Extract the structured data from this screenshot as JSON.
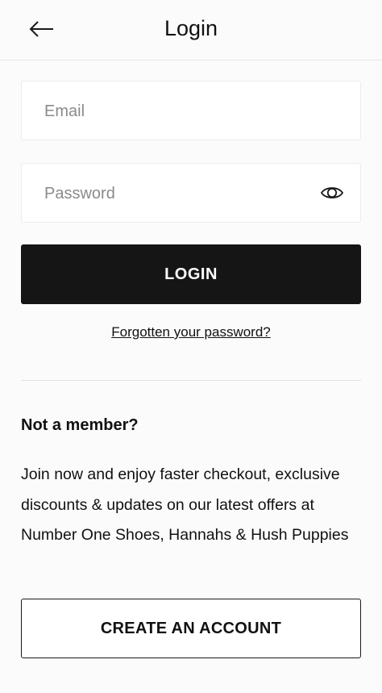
{
  "header": {
    "title": "Login",
    "back_icon": "arrow-left-icon"
  },
  "form": {
    "email_placeholder": "Email",
    "email_value": "",
    "password_placeholder": "Password",
    "password_value": "",
    "show_password_icon": "eye-icon",
    "login_label": "LOGIN",
    "forgot_label": "Forgotten your password?"
  },
  "member": {
    "title": "Not a member?",
    "description": "Join now and enjoy faster checkout, exclusive discounts & updates on our latest offers at Number One Shoes, Hannahs & Hush Puppies",
    "create_label": "CREATE AN ACCOUNT"
  },
  "colors": {
    "background": "#fbfbfb",
    "primary_button": "#151515",
    "text": "#111111"
  }
}
